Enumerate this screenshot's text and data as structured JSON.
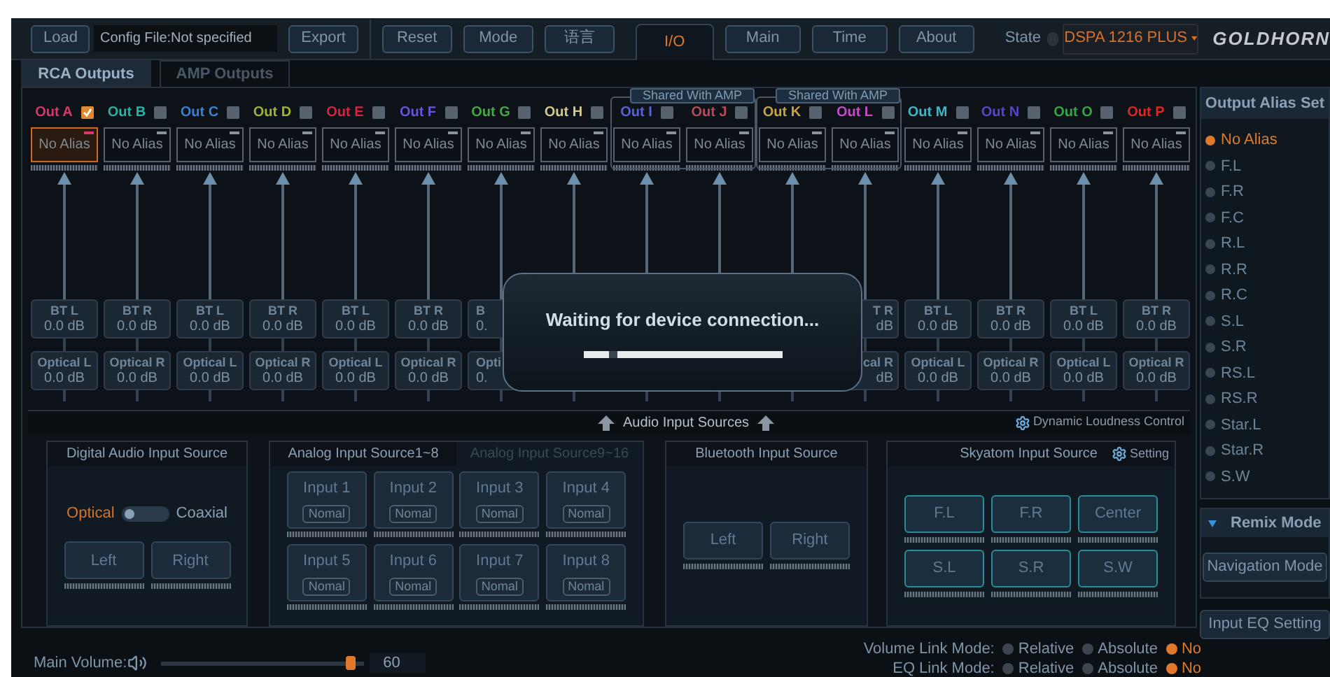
{
  "toolbar": {
    "load": "Load",
    "config_file": "Config File:Not specified",
    "export": "Export",
    "buttons": [
      "Reset",
      "Mode",
      "语言"
    ]
  },
  "top_tabs": [
    {
      "label": "I/O",
      "selected": true
    },
    {
      "label": "Main",
      "selected": false
    },
    {
      "label": "Time",
      "selected": false
    },
    {
      "label": "About",
      "selected": false
    }
  ],
  "state": {
    "label": "State",
    "connected": false
  },
  "device": "DSPA 1216 PLUS",
  "logo": "GOLDHORN",
  "output_tabs": [
    {
      "label": "RCA Outputs",
      "selected": true
    },
    {
      "label": "AMP Outputs",
      "selected": false
    }
  ],
  "outputs": [
    {
      "kind": "output",
      "name": "Out A",
      "color": "#d8386a",
      "checked": true,
      "selected": true,
      "alias": "No Alias",
      "bt": {
        "label": "BT L",
        "value": "0.0 dB"
      },
      "optical": {
        "label": "Optical L",
        "value": "0.0 dB"
      }
    },
    {
      "kind": "output",
      "name": "Out B",
      "color": "#22b4a4",
      "checked": false,
      "selected": false,
      "alias": "No Alias",
      "bt": {
        "label": "BT R",
        "value": "0.0 dB"
      },
      "optical": {
        "label": "Optical R",
        "value": "0.0 dB"
      }
    },
    {
      "kind": "output",
      "name": "Out C",
      "color": "#3a80d4",
      "checked": false,
      "selected": false,
      "alias": "No Alias",
      "bt": {
        "label": "BT L",
        "value": "0.0 dB"
      },
      "optical": {
        "label": "Optical L",
        "value": "0.0 dB"
      }
    },
    {
      "kind": "output",
      "name": "Out D",
      "color": "#a4b234",
      "checked": false,
      "selected": false,
      "alias": "No Alias",
      "bt": {
        "label": "BT R",
        "value": "0.0 dB"
      },
      "optical": {
        "label": "Optical R",
        "value": "0.0 dB"
      }
    },
    {
      "kind": "output",
      "name": "Out E",
      "color": "#d82444",
      "checked": false,
      "selected": false,
      "alias": "No Alias",
      "bt": {
        "label": "BT L",
        "value": "0.0 dB"
      },
      "optical": {
        "label": "Optical L",
        "value": "0.0 dB"
      }
    },
    {
      "kind": "output",
      "name": "Out F",
      "color": "#6a54dc",
      "checked": false,
      "selected": false,
      "alias": "No Alias",
      "bt": {
        "label": "BT R",
        "value": "0.0 dB"
      },
      "optical": {
        "label": "Optical R",
        "value": "0.0 dB"
      }
    },
    {
      "kind": "output",
      "name": "Out G",
      "color": "#44a844",
      "checked": false,
      "selected": false,
      "alias": "No Alias",
      "bt": {
        "kind": "clipped_right",
        "label": "B",
        "value": "0."
      },
      "optical": {
        "kind": "clipped_right",
        "label": "Opti",
        "value": "0."
      }
    },
    {
      "kind": "output",
      "name": "Out H",
      "color": "#d6c88a",
      "checked": false,
      "selected": false,
      "alias": "No Alias"
    },
    {
      "kind": "shared",
      "label": "Shared With AMP",
      "outputs": [
        {
          "kind": "output",
          "name": "Out I",
          "color": "#5a64d8",
          "checked": false,
          "selected": false,
          "alias": "No Alias"
        },
        {
          "kind": "output",
          "name": "Out J",
          "color": "#b84c5c",
          "checked": false,
          "selected": false,
          "alias": "No Alias"
        }
      ]
    },
    {
      "kind": "shared",
      "label": "Shared With AMP",
      "outputs": [
        {
          "kind": "output",
          "name": "Out K",
          "color": "#c8a444",
          "checked": false,
          "selected": false,
          "alias": "No Alias"
        },
        {
          "kind": "output",
          "name": "Out L",
          "color": "#c44cc8",
          "checked": false,
          "selected": false,
          "alias": "No Alias",
          "bt": {
            "kind": "clipped_left",
            "label": "T R",
            "value": "dB"
          },
          "optical": {
            "kind": "clipped_left",
            "label": "cal R",
            "value": "dB"
          }
        }
      ]
    },
    {
      "kind": "output",
      "name": "Out M",
      "color": "#44b4c4",
      "checked": false,
      "selected": false,
      "alias": "No Alias",
      "bt": {
        "label": "BT L",
        "value": "0.0 dB"
      },
      "optical": {
        "label": "Optical L",
        "value": "0.0 dB"
      }
    },
    {
      "kind": "output",
      "name": "Out N",
      "color": "#5a44cc",
      "checked": false,
      "selected": false,
      "alias": "No Alias",
      "bt": {
        "label": "BT R",
        "value": "0.0 dB"
      },
      "optical": {
        "label": "Optical R",
        "value": "0.0 dB"
      }
    },
    {
      "kind": "output",
      "name": "Out O",
      "color": "#34a844",
      "checked": false,
      "selected": false,
      "alias": "No Alias",
      "bt": {
        "label": "BT L",
        "value": "0.0 dB"
      },
      "optical": {
        "label": "Optical L",
        "value": "0.0 dB"
      }
    },
    {
      "kind": "output",
      "name": "Out P",
      "color": "#e42424",
      "checked": false,
      "selected": false,
      "alias": "No Alias",
      "bt": {
        "label": "BT R",
        "value": "0.0 dB"
      },
      "optical": {
        "label": "Optical R",
        "value": "0.0 dB"
      }
    }
  ],
  "dialog": {
    "message": "Waiting for device connection..."
  },
  "input_header": {
    "title": "Audio Input Sources",
    "loudness": "Dynamic Loudness Control"
  },
  "digital": {
    "title": "Digital Audio Input Source",
    "options": [
      {
        "label": "Optical",
        "selected": true
      },
      {
        "label": "Coaxial",
        "selected": false
      }
    ],
    "channels": [
      "Left",
      "Right"
    ]
  },
  "analog": {
    "tabs": [
      {
        "label": "Analog Input Source1~8",
        "selected": true
      },
      {
        "label": "Analog Input Source9~16",
        "selected": false
      }
    ],
    "inputs": [
      {
        "label": "Input 1",
        "mode": "Nomal"
      },
      {
        "label": "Input 2",
        "mode": "Nomal"
      },
      {
        "label": "Input 3",
        "mode": "Nomal"
      },
      {
        "label": "Input 4",
        "mode": "Nomal"
      },
      {
        "label": "Input 5",
        "mode": "Nomal"
      },
      {
        "label": "Input 6",
        "mode": "Nomal"
      },
      {
        "label": "Input 7",
        "mode": "Nomal"
      },
      {
        "label": "Input 8",
        "mode": "Nomal"
      }
    ]
  },
  "bluetooth": {
    "title": "Bluetooth Input Source",
    "channels": [
      "Left",
      "Right"
    ]
  },
  "skyatom": {
    "title": "Skyatom Input Source",
    "setting": "Setting",
    "channels": [
      "F.L",
      "F.R",
      "Center",
      "S.L",
      "S.R",
      "S.W"
    ]
  },
  "alias_panel": {
    "title": "Output Alias Set",
    "items": [
      {
        "label": "No Alias",
        "selected": true
      },
      {
        "label": "F.L",
        "selected": false
      },
      {
        "label": "F.R",
        "selected": false
      },
      {
        "label": "F.C",
        "selected": false
      },
      {
        "label": "R.L",
        "selected": false
      },
      {
        "label": "R.R",
        "selected": false
      },
      {
        "label": "R.C",
        "selected": false
      },
      {
        "label": "S.L",
        "selected": false
      },
      {
        "label": "S.R",
        "selected": false
      },
      {
        "label": "RS.L",
        "selected": false
      },
      {
        "label": "RS.R",
        "selected": false
      },
      {
        "label": "Star.L",
        "selected": false
      },
      {
        "label": "Star.R",
        "selected": false
      },
      {
        "label": "S.W",
        "selected": false
      }
    ]
  },
  "remix": {
    "title": "Remix Mode",
    "expanded": true,
    "button": "Navigation Mode"
  },
  "input_eq": "Input EQ Setting",
  "main_volume": {
    "label": "Main Volume:",
    "level": 0.96,
    "value": "60"
  },
  "link_modes": [
    {
      "label": "Volume Link Mode:",
      "options": [
        {
          "label": "Relative",
          "selected": false
        },
        {
          "label": "Absolute",
          "selected": false
        },
        {
          "label": "No",
          "selected": true
        }
      ]
    },
    {
      "label": "EQ Link Mode:",
      "options": [
        {
          "label": "Relative",
          "selected": false
        },
        {
          "label": "Absolute",
          "selected": false
        },
        {
          "label": "No",
          "selected": true
        }
      ]
    }
  ]
}
